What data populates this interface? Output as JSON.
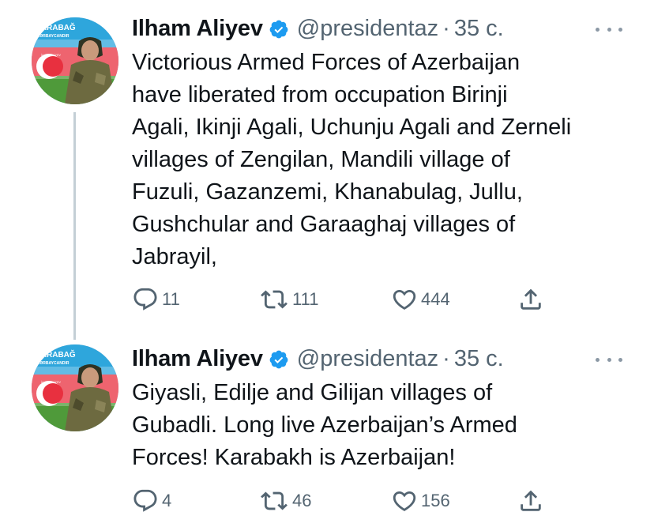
{
  "tweets": [
    {
      "author": {
        "name": "Ilham Aliyev",
        "handle": "@presidentaz"
      },
      "separator": "·",
      "time": "35 с.",
      "avatar_text": {
        "top": "QARABAĞ",
        "middle": "AZƏRBAYCANDIR",
        "small": "İLHAM ƏLİYEV"
      },
      "text_lines": [
        "Victorious Armed Forces of Azerbaijan",
        "have liberated from occupation Birinji",
        "Agali, Ikinji Agali, Uchunju Agali and Zerneli",
        "villages of Zengilan, Mandili village of",
        "Fuzuli, Gazanzemi, Khanabulag, Jullu,",
        "Gushchular and Garaaghaj villages of",
        "Jabrayil,"
      ],
      "stats": {
        "replies": "11",
        "retweets": "111",
        "likes": "444"
      }
    },
    {
      "author": {
        "name": "Ilham Aliyev",
        "handle": "@presidentaz"
      },
      "separator": "·",
      "time": "35 с.",
      "avatar_text": {
        "top": "QARABAĞ",
        "middle": "AZƏRBAYCANDIR",
        "small": "İLHAM ƏLİYEV"
      },
      "text_lines": [
        "Giyasli, Edilje and Gilijan villages of",
        "Gubadli. Long live Azerbaijan’s Armed",
        "Forces! Karabakh is Azerbaijan!"
      ],
      "stats": {
        "replies": "4",
        "retweets": "46",
        "likes": "156"
      }
    }
  ],
  "icons": {
    "verified": "verified-badge-icon",
    "more": "more-dots-icon",
    "reply": "reply-bubble-icon",
    "retweet": "retweet-arrows-icon",
    "like": "heart-icon",
    "share": "share-upload-icon"
  },
  "colors": {
    "text_primary": "#0f1419",
    "text_secondary": "#536471",
    "verified_blue": "#1d9bf0",
    "thread_line": "#c4cfd6",
    "flag_blue": "#00b5e2",
    "flag_red": "#ef3340",
    "flag_green": "#509e2f"
  }
}
